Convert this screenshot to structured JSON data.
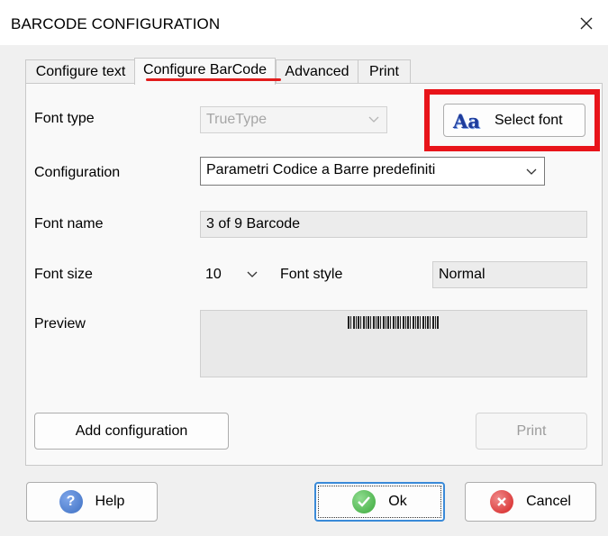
{
  "window": {
    "title": "BARCODE CONFIGURATION",
    "close_icon": "close-icon"
  },
  "tabs": [
    {
      "label": "Configure text",
      "active": false
    },
    {
      "label": "Configure BarCode",
      "active": true
    },
    {
      "label": "Advanced",
      "active": false
    },
    {
      "label": "Print",
      "active": false
    }
  ],
  "form": {
    "font_type_label": "Font type",
    "font_type_value": "TrueType",
    "select_font_label": "Select font",
    "select_font_icon_text": "Aa",
    "configuration_label": "Configuration",
    "configuration_value": "Parametri Codice a Barre predefiniti",
    "font_name_label": "Font name",
    "font_name_value": "3 of 9 Barcode",
    "font_size_label": "Font size",
    "font_size_value": "10",
    "font_style_label": "Font style",
    "font_style_value": "Normal",
    "preview_label": "Preview",
    "add_configuration_label": "Add configuration",
    "print_label": "Print"
  },
  "footer": {
    "help_label": "Help",
    "help_icon_text": "?",
    "ok_label": "Ok",
    "cancel_label": "Cancel"
  },
  "colors": {
    "highlight": "#e8141a",
    "underline": "#e21c1c",
    "help_icon": "#3d6fc2",
    "ok_icon": "#3aa83a",
    "cancel_icon": "#d42020"
  }
}
